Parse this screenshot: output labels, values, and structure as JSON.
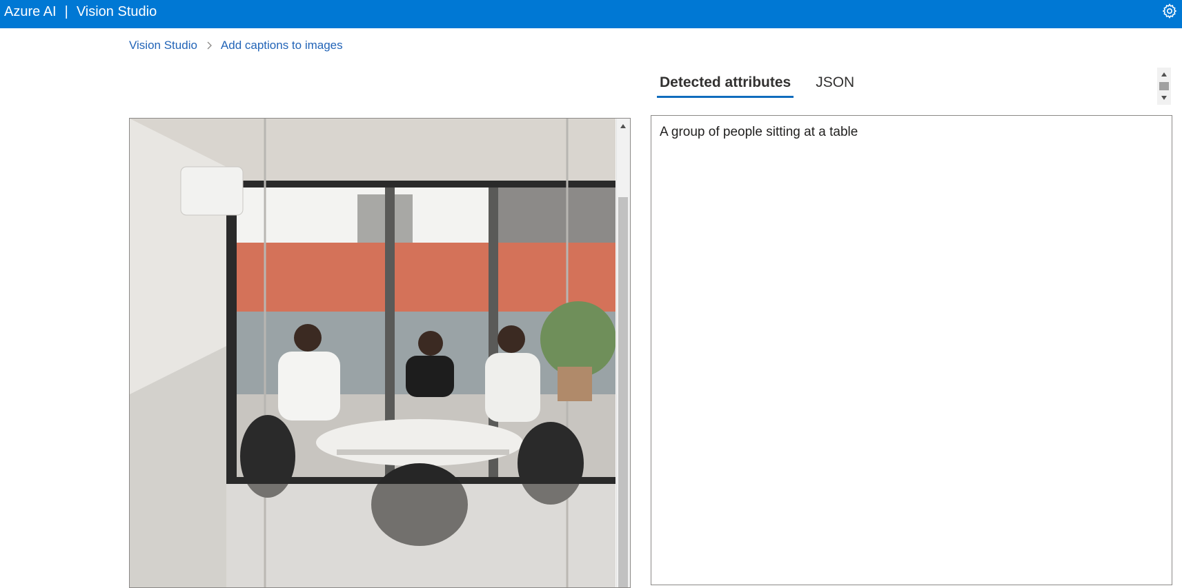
{
  "header": {
    "brand": "Azure AI",
    "separator": "|",
    "product": "Vision Studio",
    "settings_icon": "gear-icon"
  },
  "breadcrumb": {
    "items": [
      "Vision Studio",
      "Add captions to images"
    ],
    "separator_icon": "chevron-right-icon"
  },
  "image_panel": {
    "image_description_icon": "photo-meeting-room"
  },
  "tabs": [
    {
      "label": "Detected attributes",
      "active": true
    },
    {
      "label": "JSON",
      "active": false
    }
  ],
  "result": {
    "caption": "A group of people sitting at a table"
  },
  "colors": {
    "header_bg": "#0078d4",
    "link": "#2264b7",
    "tab_underline": "#0f6cbd"
  }
}
